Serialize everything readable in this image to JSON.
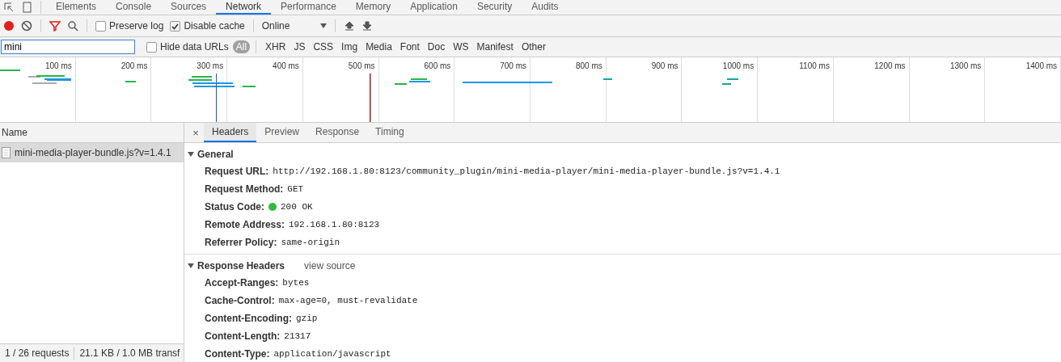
{
  "panel_tabs": [
    {
      "label": "Elements",
      "selected": false
    },
    {
      "label": "Console",
      "selected": false
    },
    {
      "label": "Sources",
      "selected": false
    },
    {
      "label": "Network",
      "selected": true
    },
    {
      "label": "Performance",
      "selected": false
    },
    {
      "label": "Memory",
      "selected": false
    },
    {
      "label": "Application",
      "selected": false
    },
    {
      "label": "Security",
      "selected": false
    },
    {
      "label": "Audits",
      "selected": false
    }
  ],
  "toolbar": {
    "recording": true,
    "preserve_log": {
      "label": "Preserve log",
      "checked": false
    },
    "disable_cache": {
      "label": "Disable cache",
      "checked": true
    },
    "throttling": "Online"
  },
  "filter": {
    "value": "mini",
    "hide_data_urls": {
      "label": "Hide data URLs",
      "checked": false
    },
    "types": [
      {
        "label": "All",
        "selected": true
      },
      {
        "label": "XHR",
        "selected": false
      },
      {
        "label": "JS",
        "selected": false
      },
      {
        "label": "CSS",
        "selected": false
      },
      {
        "label": "Img",
        "selected": false
      },
      {
        "label": "Media",
        "selected": false
      },
      {
        "label": "Font",
        "selected": false
      },
      {
        "label": "Doc",
        "selected": false
      },
      {
        "label": "WS",
        "selected": false
      },
      {
        "label": "Manifest",
        "selected": false
      },
      {
        "label": "Other",
        "selected": false
      }
    ]
  },
  "timeline": {
    "ticks": [
      "100 ms",
      "200 ms",
      "300 ms",
      "400 ms",
      "500 ms",
      "600 ms",
      "700 ms",
      "800 ms",
      "900 ms",
      "1000 ms",
      "1100 ms",
      "1200 ms",
      "1300 ms",
      "1400 ms"
    ]
  },
  "requests": {
    "column": "Name",
    "rows": [
      {
        "name": "mini-media-player-bundle.js?v=1.4.1",
        "selected": true
      }
    ]
  },
  "status_bar": [
    "1 / 26 requests",
    "21.1 KB / 1.0 MB transf"
  ],
  "details": {
    "close": "×",
    "tabs": [
      {
        "label": "Headers",
        "selected": true
      },
      {
        "label": "Preview",
        "selected": false
      },
      {
        "label": "Response",
        "selected": false
      },
      {
        "label": "Timing",
        "selected": false
      }
    ],
    "sections": [
      {
        "title": "General",
        "expanded": true,
        "rows": [
          {
            "key": "Request URL:",
            "value": "http://192.168.1.80:8123/community_plugin/mini-media-player/mini-media-player-bundle.js?v=1.4.1"
          },
          {
            "key": "Request Method:",
            "value": "GET"
          },
          {
            "key": "Status Code:",
            "value": "200 OK",
            "kind": "status"
          },
          {
            "key": "Remote Address:",
            "value": "192.168.1.80:8123"
          },
          {
            "key": "Referrer Policy:",
            "value": "same-origin"
          }
        ]
      },
      {
        "title": "Response Headers",
        "link": "view source",
        "expanded": true,
        "rows": [
          {
            "key": "Accept-Ranges:",
            "value": "bytes"
          },
          {
            "key": "Cache-Control:",
            "value": "max-age=0, must-revalidate"
          },
          {
            "key": "Content-Encoding:",
            "value": "gzip"
          },
          {
            "key": "Content-Length:",
            "value": "21317"
          },
          {
            "key": "Content-Type:",
            "value": "application/javascript"
          }
        ]
      }
    ]
  }
}
